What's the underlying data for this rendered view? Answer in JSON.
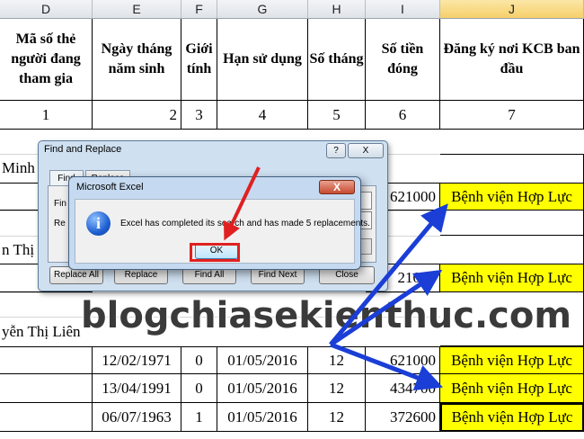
{
  "columns": [
    "D",
    "E",
    "F",
    "G",
    "H",
    "I",
    "J"
  ],
  "selected_column": "J",
  "headers": {
    "D": "Mã số thẻ người đang tham gia",
    "E": "Ngày tháng năm sinh",
    "F": "Giới tính",
    "G": "Hạn sử dụng",
    "H": "Số tháng",
    "I": "Số tiền đóng",
    "J": "Đăng ký nơi KCB ban đầu"
  },
  "index_row": [
    "1",
    "2",
    "3",
    "4",
    "5",
    "6",
    "7"
  ],
  "name_fragments": [
    "Minh C",
    "n Thị",
    "yễn Thị Liên"
  ],
  "visible_amounts": [
    "621000",
    "21000"
  ],
  "hospital": "Bệnh viện Hợp Lực",
  "rows": [
    {
      "dob": "12/02/1971",
      "gender": "0",
      "expiry": "01/05/2016",
      "months": "12",
      "amount": "621000",
      "hospital": "Bệnh viện Hợp Lực"
    },
    {
      "dob": "13/04/1991",
      "gender": "0",
      "expiry": "01/05/2016",
      "months": "12",
      "amount": "434700",
      "hospital": "Bệnh viện Hợp Lực"
    },
    {
      "dob": "06/07/1963",
      "gender": "1",
      "expiry": "01/05/2016",
      "months": "12",
      "amount": "372600",
      "hospital": "Bệnh viện Hợp Lực"
    }
  ],
  "find_replace": {
    "title": "Find and Replace",
    "help": "?",
    "close": "X",
    "tabs": [
      "Find",
      "Replace"
    ],
    "field_labels": [
      "Fin",
      "Re"
    ],
    "buttons": [
      "Replace All",
      "Replace",
      "Find All",
      "Find Next",
      "Close"
    ]
  },
  "message_box": {
    "title": "Microsoft Excel",
    "close": "X",
    "icon": "i",
    "text": "Excel has completed its search and has made 5 replacements.",
    "ok": "OK"
  },
  "watermark": "blogchiasekienthuc.com",
  "colors": {
    "highlight": "#ffff00",
    "arrow_blue": "#1a3ed6",
    "arrow_red": "#e02020"
  }
}
